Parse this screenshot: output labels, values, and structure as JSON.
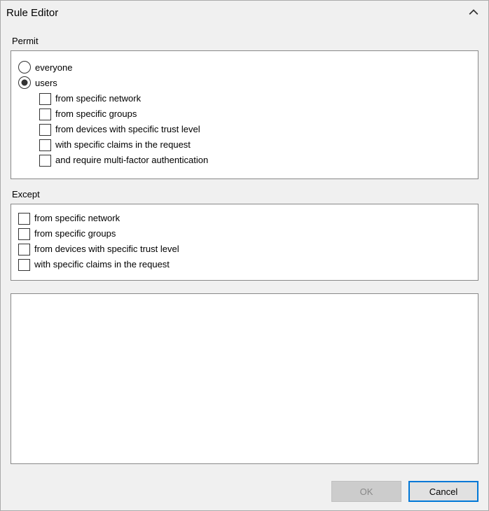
{
  "title": "Rule Editor",
  "sections": {
    "permit": {
      "label": "Permit",
      "radios": {
        "everyone": {
          "label": "everyone",
          "selected": false
        },
        "users": {
          "label": "users",
          "selected": true
        }
      },
      "user_checks": [
        {
          "label": "from specific network"
        },
        {
          "label": "from specific groups"
        },
        {
          "label": "from devices with specific trust level"
        },
        {
          "label": "with specific claims in the request"
        },
        {
          "label": "and require multi-factor authentication"
        }
      ]
    },
    "except": {
      "label": "Except",
      "checks": [
        {
          "label": "from specific network"
        },
        {
          "label": "from specific groups"
        },
        {
          "label": "from devices with specific trust level"
        },
        {
          "label": "with specific claims in the request"
        }
      ]
    }
  },
  "buttons": {
    "ok": "OK",
    "cancel": "Cancel"
  }
}
